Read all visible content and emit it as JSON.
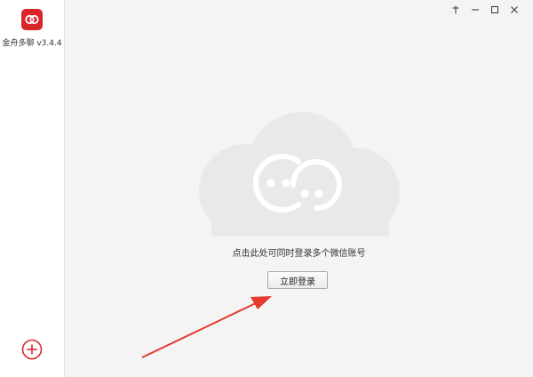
{
  "app": {
    "name": "金舟多聊",
    "version": "v3.4.4",
    "brand_color": "#d8262a"
  },
  "sidebar": {
    "add_icon": "plus-circle-icon"
  },
  "window_controls": {
    "icons": [
      "pin-icon",
      "minimize-icon",
      "maximize-icon",
      "close-icon"
    ]
  },
  "main": {
    "illustration_icon": "chat-cloud-icon",
    "hint_text": "点击此处可同时登录多个微信账号",
    "login_button_label": "立即登录"
  },
  "annotation": {
    "arrow_color": "#e53a2c"
  }
}
